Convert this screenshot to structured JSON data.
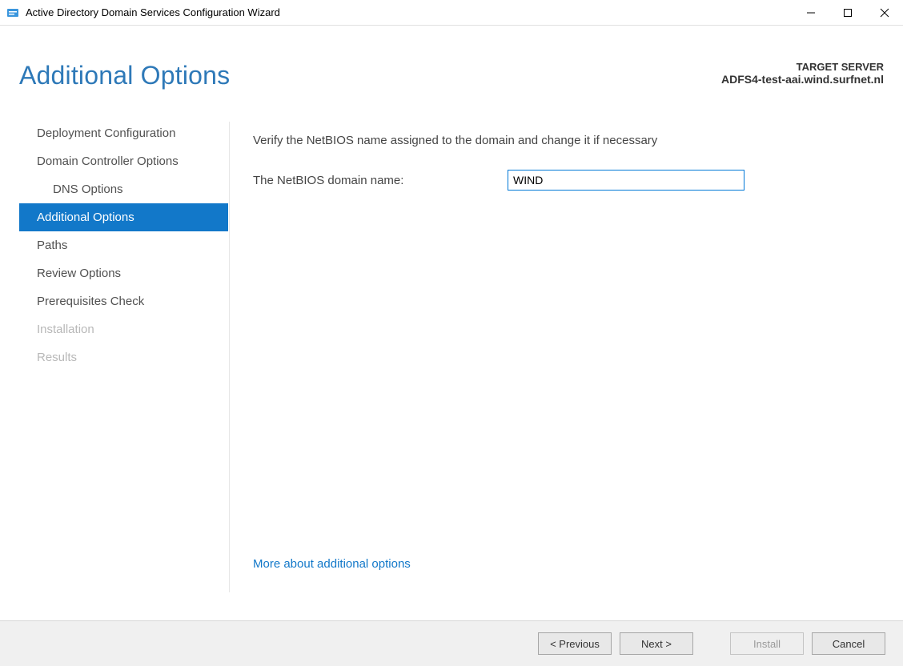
{
  "window": {
    "title": "Active Directory Domain Services Configuration Wizard"
  },
  "header": {
    "page_title": "Additional Options",
    "target_label": "TARGET SERVER",
    "target_value": "ADFS4-test-aai.wind.surfnet.nl"
  },
  "sidebar": {
    "items": [
      {
        "label": "Deployment Configuration",
        "indent": false,
        "disabled": false,
        "selected": false
      },
      {
        "label": "Domain Controller Options",
        "indent": false,
        "disabled": false,
        "selected": false
      },
      {
        "label": "DNS Options",
        "indent": true,
        "disabled": false,
        "selected": false
      },
      {
        "label": "Additional Options",
        "indent": false,
        "disabled": false,
        "selected": true
      },
      {
        "label": "Paths",
        "indent": false,
        "disabled": false,
        "selected": false
      },
      {
        "label": "Review Options",
        "indent": false,
        "disabled": false,
        "selected": false
      },
      {
        "label": "Prerequisites Check",
        "indent": false,
        "disabled": false,
        "selected": false
      },
      {
        "label": "Installation",
        "indent": false,
        "disabled": true,
        "selected": false
      },
      {
        "label": "Results",
        "indent": false,
        "disabled": true,
        "selected": false
      }
    ]
  },
  "main": {
    "instruction": "Verify the NetBIOS name assigned to the domain and change it if necessary",
    "field_label": "The NetBIOS domain name:",
    "field_value": "WIND",
    "more_link": "More about additional options"
  },
  "footer": {
    "previous": "< Previous",
    "next": "Next >",
    "install": "Install",
    "cancel": "Cancel"
  }
}
